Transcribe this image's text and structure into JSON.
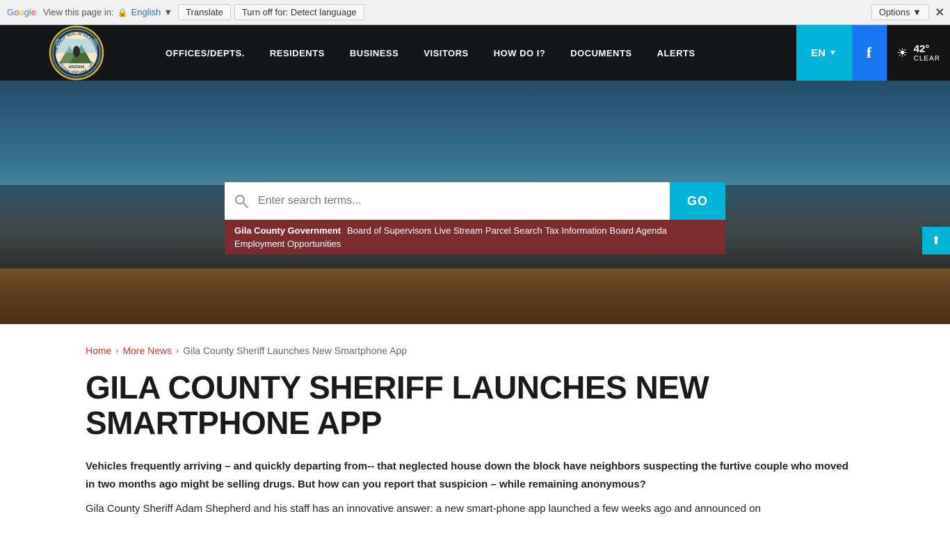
{
  "translate_bar": {
    "prefix": "View this page in:",
    "language_link": "English",
    "lang_dropdown": "▼",
    "translate_btn": "Translate",
    "turnoff_btn": "Turn off for: Detect language",
    "options_btn": "Options ▼",
    "close_btn": "✕"
  },
  "nav": {
    "items": [
      {
        "label": "OFFICES/DEPTS.",
        "id": "offices"
      },
      {
        "label": "RESIDENTS",
        "id": "residents"
      },
      {
        "label": "BUSINESS",
        "id": "business"
      },
      {
        "label": "VISITORS",
        "id": "visitors"
      },
      {
        "label": "HOW DO I?",
        "id": "how-do-i"
      },
      {
        "label": "DOCUMENTS",
        "id": "documents"
      },
      {
        "label": "ALERTS",
        "id": "alerts"
      }
    ],
    "language": "EN",
    "language_arrow": "▼",
    "facebook_label": "f",
    "weather_temp": "42°",
    "weather_desc": "CLEAR"
  },
  "search": {
    "placeholder": "Enter search terms...",
    "go_label": "GO",
    "site_name": "Gila County Government",
    "quick_links": [
      "Board of Supervisors",
      "Live Stream",
      "Parcel Search",
      "Tax Information",
      "Board Agenda",
      "Employment Opportunities"
    ]
  },
  "share": {
    "icon": "⬆"
  },
  "breadcrumb": {
    "home": "Home",
    "more_news": "More News",
    "current": "Gila County Sheriff Launches New Smartphone App"
  },
  "article": {
    "title": "GILA COUNTY SHERIFF LAUNCHES NEW SMARTPHONE APP",
    "intro": "Vehicles frequently arriving – and quickly departing from-- that neglected house down the block have neighbors suspecting the furtive couple who moved in two months ago might be selling drugs. But how can you report that suspicion – while remaining anonymous?",
    "body": "Gila County Sheriff Adam Shepherd and his staff has an innovative answer: a new smart-phone app launched a few weeks ago and announced on"
  }
}
